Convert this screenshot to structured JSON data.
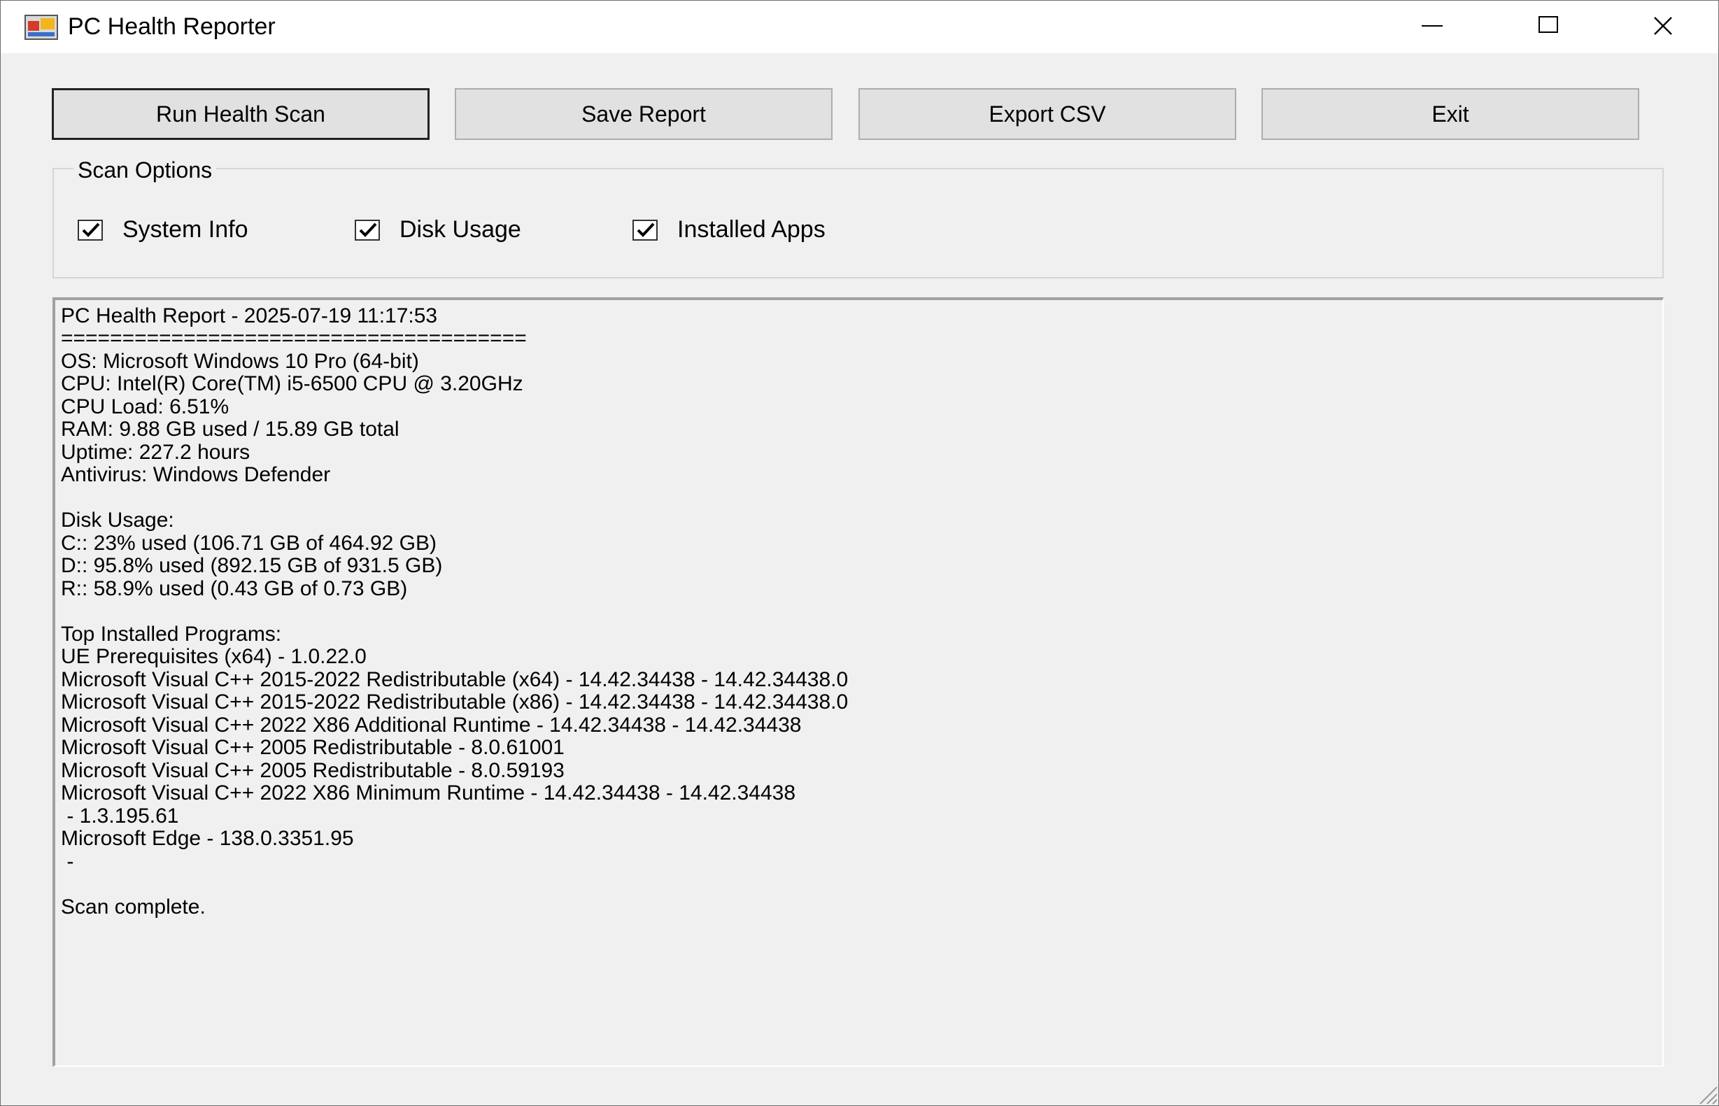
{
  "window": {
    "title": "PC Health Reporter",
    "icon": "app-window-icon",
    "controls": {
      "minimize_icon": "minimize-icon",
      "maximize_icon": "maximize-icon",
      "close_icon": "close-icon"
    }
  },
  "toolbar": {
    "run_scan_label": "Run Health Scan",
    "save_report_label": "Save Report",
    "export_csv_label": "Export CSV",
    "exit_label": "Exit"
  },
  "scan_options": {
    "title": "Scan Options",
    "items": [
      {
        "label": "System Info",
        "checked": true
      },
      {
        "label": "Disk Usage",
        "checked": true
      },
      {
        "label": "Installed Apps",
        "checked": true
      }
    ]
  },
  "report": {
    "lines": [
      "PC Health Report - 2025-07-19 11:17:53",
      "======================================",
      "OS: Microsoft Windows 10 Pro (64-bit)",
      "CPU: Intel(R) Core(TM) i5-6500 CPU @ 3.20GHz",
      "CPU Load: 6.51%",
      "RAM: 9.88 GB used / 15.89 GB total",
      "Uptime: 227.2 hours",
      "Antivirus: Windows Defender",
      "",
      "Disk Usage:",
      "C:: 23% used (106.71 GB of 464.92 GB)",
      "D:: 95.8% used (892.15 GB of 931.5 GB)",
      "R:: 58.9% used (0.43 GB of 0.73 GB)",
      "",
      "Top Installed Programs:",
      "UE Prerequisites (x64) - 1.0.22.0",
      "Microsoft Visual C++ 2015-2022 Redistributable (x64) - 14.42.34438 - 14.42.34438.0",
      "Microsoft Visual C++ 2015-2022 Redistributable (x86) - 14.42.34438 - 14.42.34438.0",
      "Microsoft Visual C++ 2022 X86 Additional Runtime - 14.42.34438 - 14.42.34438",
      "Microsoft Visual C++ 2005 Redistributable - 8.0.61001",
      "Microsoft Visual C++ 2005 Redistributable - 8.0.59193",
      "Microsoft Visual C++ 2022 X86 Minimum Runtime - 14.42.34438 - 14.42.34438",
      " - 1.3.195.61",
      "Microsoft Edge - 138.0.3351.95",
      " - ",
      "",
      "Scan complete."
    ]
  },
  "colors": {
    "window_bg": "#f0f0f0",
    "titlebar_bg": "#ffffff",
    "button_bg": "#e1e1e1",
    "button_border": "#adadad"
  }
}
